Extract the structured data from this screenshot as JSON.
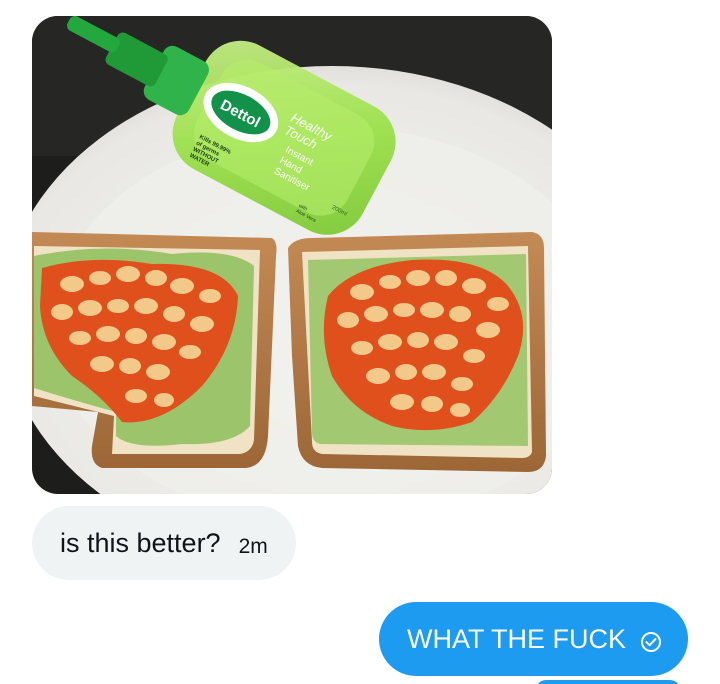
{
  "messages": {
    "received_text": "is this better?",
    "received_time": "2m",
    "sent_text": "WHAT THE FUCK"
  },
  "photo": {
    "label_brand": "Dettol",
    "label_line1": "Healthy",
    "label_line2": "Touch",
    "label_line3": "Instant",
    "label_line4": "Hand",
    "label_line5": "Sanitiser",
    "label_claim1": "Kills 99.99%",
    "label_claim2": "of germs",
    "label_claim3": "WITHOUT",
    "label_claim4": "WATER",
    "label_extra1": "with",
    "label_extra2": "Aloe Vera",
    "label_volume": "200ml"
  },
  "colors": {
    "sent_bubble": "#1d9bf0",
    "received_bubble": "#eff3f4"
  },
  "icons": {
    "read_receipt": "check-circle-icon"
  }
}
